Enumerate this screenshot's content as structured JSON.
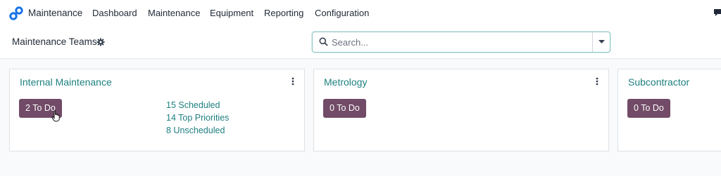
{
  "navbar": {
    "app_name": "Maintenance",
    "menus": [
      "Dashboard",
      "Maintenance",
      "Equipment",
      "Reporting",
      "Configuration"
    ],
    "logo_icon": "app-logo-icon",
    "chat_icon": "chat-icon"
  },
  "control_panel": {
    "breadcrumb": "Maintenance Teams",
    "settings_icon": "gear-icon",
    "search": {
      "placeholder": "Search...",
      "value": ""
    }
  },
  "teams": [
    {
      "name": "Internal Maintenance",
      "todo_label": "2 To Do",
      "stats": [
        "15 Scheduled",
        "14 Top Priorities",
        "8 Unscheduled"
      ]
    },
    {
      "name": "Metrology",
      "todo_label": "0 To Do"
    },
    {
      "name": "Subcontractor",
      "todo_label": "0 To Do"
    }
  ],
  "colors": {
    "primary": "#714b67",
    "link": "#1e7f80",
    "search_border": "#8fc8c6"
  }
}
